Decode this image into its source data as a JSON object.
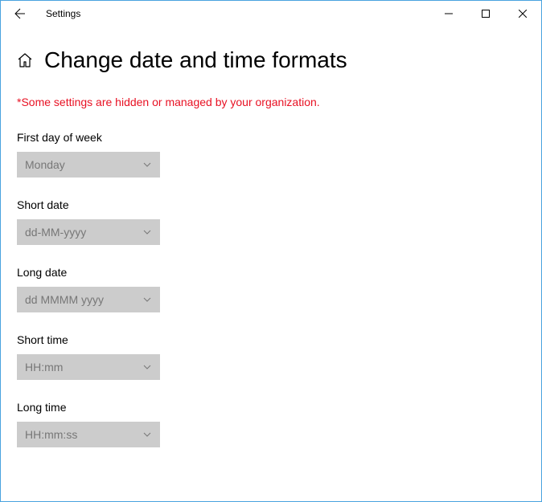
{
  "titlebar": {
    "title": "Settings"
  },
  "page": {
    "heading": "Change date and time formats"
  },
  "warning": "*Some settings are hidden or managed by your organization.",
  "fields": {
    "firstDay": {
      "label": "First day of week",
      "value": "Monday"
    },
    "shortDate": {
      "label": "Short date",
      "value": "dd-MM-yyyy"
    },
    "longDate": {
      "label": "Long date",
      "value": "dd MMMM yyyy"
    },
    "shortTime": {
      "label": "Short time",
      "value": "HH:mm"
    },
    "longTime": {
      "label": "Long time",
      "value": "HH:mm:ss"
    }
  }
}
